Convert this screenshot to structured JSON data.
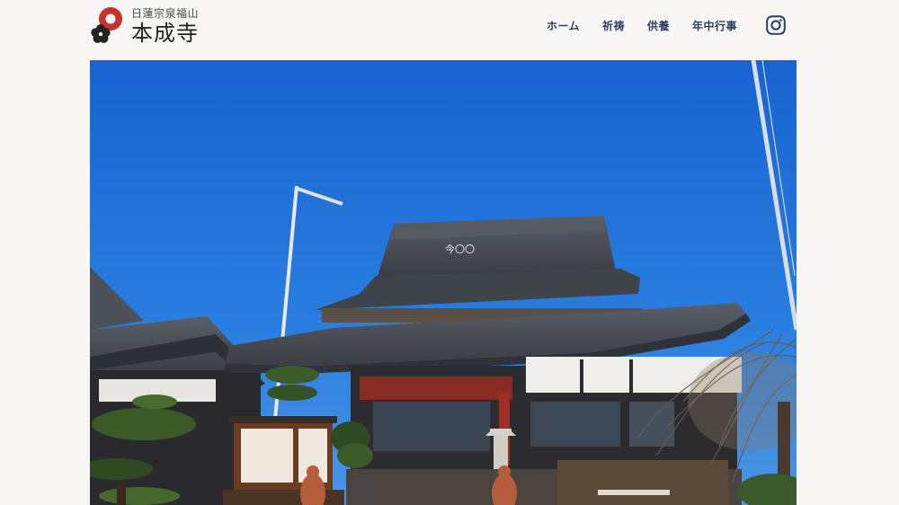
{
  "logo": {
    "subtitle": "日蓮宗泉福山",
    "title": "本成寺"
  },
  "nav": {
    "items": [
      {
        "label": "ホーム"
      },
      {
        "label": "祈祷"
      },
      {
        "label": "供養"
      },
      {
        "label": "年中行事"
      }
    ]
  },
  "social": {
    "icon": "instagram-icon"
  },
  "hero": {
    "plaque_text": "今〇〇"
  },
  "colors": {
    "accent_red": "#c8322e",
    "nav_text": "#2b3e60",
    "sky": "#1d6fd8",
    "background": "#f8f6f4"
  }
}
